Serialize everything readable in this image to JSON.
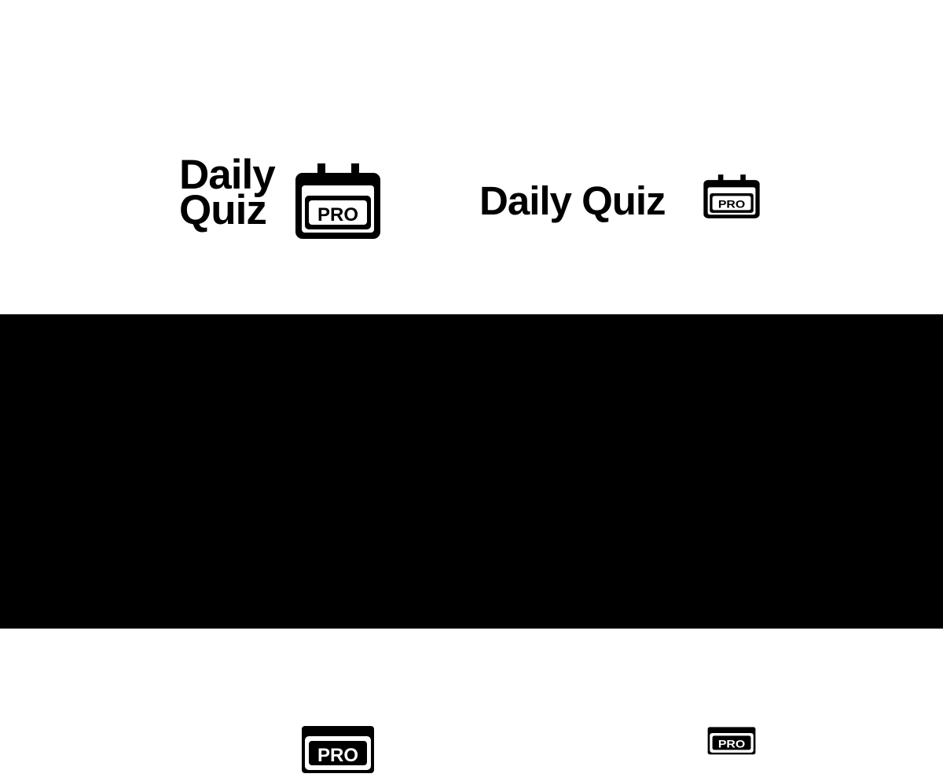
{
  "logo": {
    "line1": "Daily",
    "line2": "Quiz",
    "full": "Daily Quiz",
    "badge": "PRO"
  },
  "colors": {
    "light_bg": "#ffffff",
    "dark_bg": "#000000"
  }
}
